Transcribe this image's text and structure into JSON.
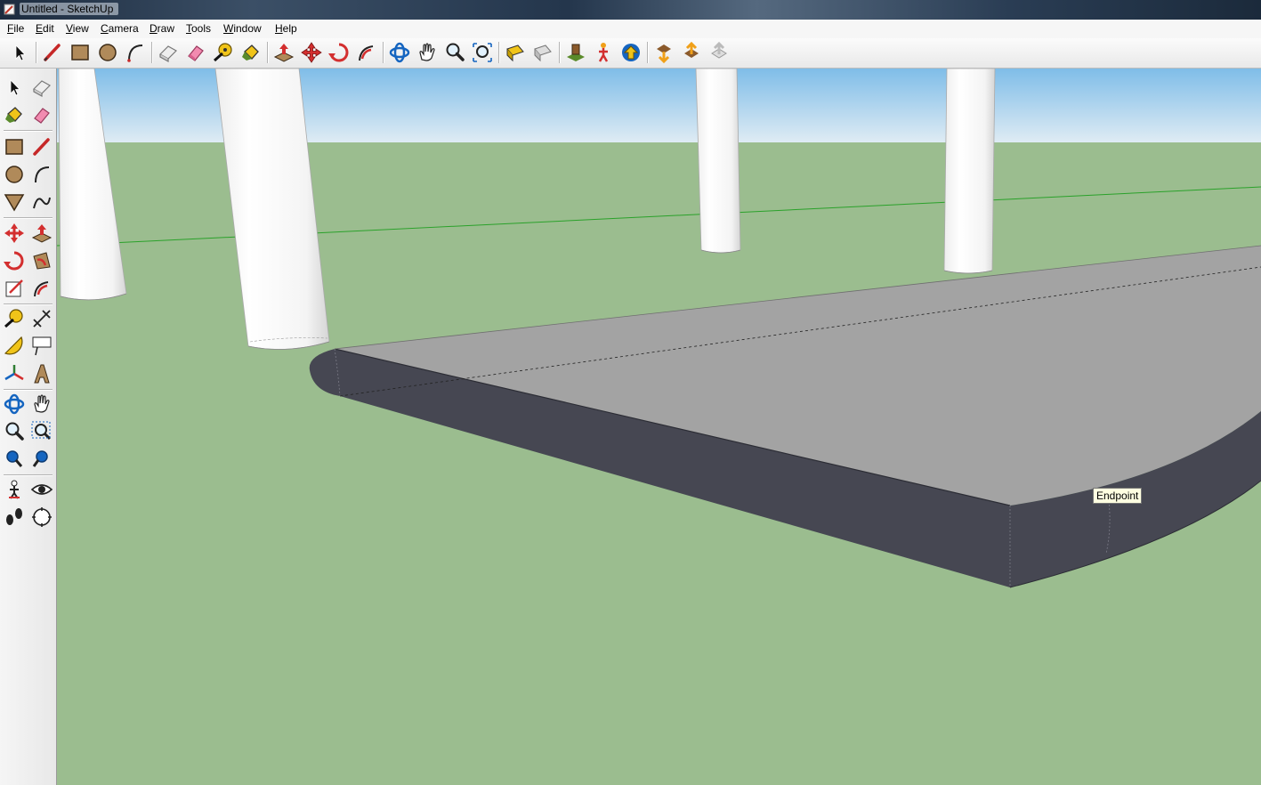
{
  "window": {
    "title": "Untitled - SketchUp"
  },
  "menu": {
    "items": [
      {
        "key": "F",
        "rest": "ile"
      },
      {
        "key": "E",
        "rest": "dit"
      },
      {
        "key": "V",
        "rest": "iew"
      },
      {
        "key": "C",
        "rest": "amera"
      },
      {
        "key": "D",
        "rest": "raw"
      },
      {
        "key": "T",
        "rest": "ools"
      },
      {
        "key": "W",
        "rest": "indow"
      },
      {
        "key": "H",
        "rest": "elp"
      }
    ]
  },
  "toolbar": {
    "icons": [
      "select-icon",
      "line-icon",
      "rectangle-icon",
      "circle-icon",
      "arc-icon",
      "make-component-icon",
      "eraser-icon",
      "tape-measure-icon",
      "paint-bucket-icon",
      "push-pull-icon",
      "move-icon",
      "rotate-icon",
      "follow-me-icon",
      "orbit-icon",
      "pan-icon",
      "zoom-icon",
      "zoom-extents-icon",
      "previous-view-icon",
      "next-view-icon",
      "position-camera-icon",
      "walk-icon",
      "look-around-icon",
      "get-models-icon",
      "share-model-icon",
      "share-component-icon"
    ]
  },
  "sidebar": {
    "icons": [
      "select-icon",
      "make-component-icon",
      "paint-bucket-icon",
      "eraser-icon",
      "rectangle-icon",
      "line-icon",
      "circle-icon",
      "arc-icon",
      "polygon-icon",
      "freehand-icon",
      "move-icon",
      "push-pull-icon",
      "rotate-icon",
      "follow-me-icon",
      "scale-icon",
      "offset-icon",
      "tape-measure-icon",
      "dimension-icon",
      "protractor-icon",
      "text-icon",
      "axes-icon",
      "3d-text-icon",
      "orbit-icon",
      "pan-icon",
      "zoom-icon",
      "zoom-window-icon",
      "zoom-extents-icon",
      "previous-view-icon",
      "position-camera-icon",
      "look-around-icon",
      "walk-icon",
      "section-plane-icon"
    ]
  },
  "viewport": {
    "tooltip": "Endpoint",
    "colors": {
      "sky_top": "#7fbde8",
      "sky_bottom": "#e0ecf4",
      "ground": "#9bbd8f",
      "top_face": "#a3a3a3",
      "side_face": "#464752",
      "cylinder": "#ffffff",
      "green_axis": "#2aa12a"
    }
  }
}
